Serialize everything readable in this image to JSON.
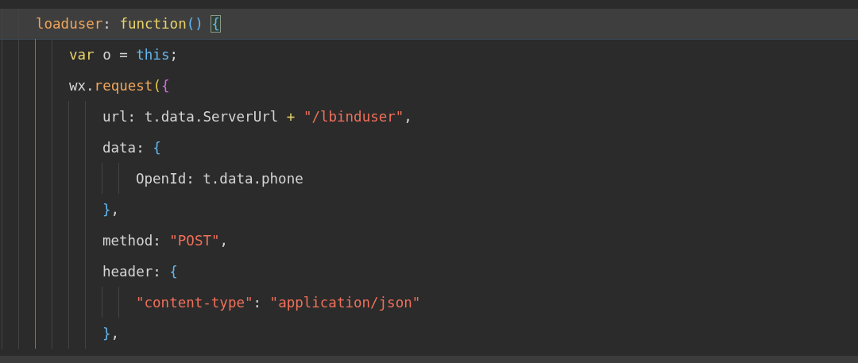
{
  "editor": {
    "lines": [
      {
        "highlighted": true,
        "tokens": [
          {
            "text": "loaduser",
            "kind": "prop"
          },
          {
            "text": ": ",
            "kind": "plain"
          },
          {
            "text": "function",
            "kind": "keyword"
          },
          {
            "text": "() ",
            "kind": "brace-blue"
          },
          {
            "text": "{",
            "kind": "brace-blue",
            "matched": true
          }
        ],
        "children": [
          {
            "highlighted": false,
            "tokens": [
              {
                "text": "var",
                "kind": "keyword"
              },
              {
                "text": " o = ",
                "kind": "plain"
              },
              {
                "text": "this",
                "kind": "builtin"
              },
              {
                "text": ";",
                "kind": "plain"
              }
            ]
          },
          {
            "highlighted": false,
            "tokens": [
              {
                "text": "wx.",
                "kind": "plain"
              },
              {
                "text": "request",
                "kind": "prop"
              },
              {
                "text": "(",
                "kind": "brace-yellow"
              },
              {
                "text": "{",
                "kind": "brace-pink"
              }
            ],
            "children": [
              {
                "highlighted": false,
                "tokens": [
                  {
                    "text": "url: t.data.ServerUrl ",
                    "kind": "plain"
                  },
                  {
                    "text": "+ ",
                    "kind": "operator"
                  },
                  {
                    "text": "\"/lbinduser\"",
                    "kind": "string"
                  },
                  {
                    "text": ",",
                    "kind": "plain"
                  }
                ]
              },
              {
                "highlighted": false,
                "tokens": [
                  {
                    "text": "data: ",
                    "kind": "plain"
                  },
                  {
                    "text": "{",
                    "kind": "brace-blue"
                  }
                ],
                "children": [
                  {
                    "highlighted": false,
                    "tokens": [
                      {
                        "text": "OpenId: t.data.phone",
                        "kind": "plain"
                      }
                    ]
                  }
                ]
              },
              {
                "highlighted": false,
                "tokens": [
                  {
                    "text": "}",
                    "kind": "brace-blue"
                  },
                  {
                    "text": ",",
                    "kind": "plain"
                  }
                ]
              },
              {
                "highlighted": false,
                "tokens": [
                  {
                    "text": "method: ",
                    "kind": "plain"
                  },
                  {
                    "text": "\"POST\"",
                    "kind": "string"
                  },
                  {
                    "text": ",",
                    "kind": "plain"
                  }
                ]
              },
              {
                "highlighted": false,
                "tokens": [
                  {
                    "text": "header: ",
                    "kind": "plain"
                  },
                  {
                    "text": "{",
                    "kind": "brace-blue"
                  }
                ],
                "children": [
                  {
                    "highlighted": false,
                    "tokens": [
                      {
                        "text": "\"content-type\"",
                        "kind": "string"
                      },
                      {
                        "text": ": ",
                        "kind": "plain"
                      },
                      {
                        "text": "\"application/json\"",
                        "kind": "string"
                      }
                    ]
                  }
                ]
              },
              {
                "highlighted": false,
                "tokens": [
                  {
                    "text": "}",
                    "kind": "brace-blue"
                  },
                  {
                    "text": ",",
                    "kind": "plain"
                  }
                ]
              }
            ]
          }
        ]
      }
    ]
  }
}
